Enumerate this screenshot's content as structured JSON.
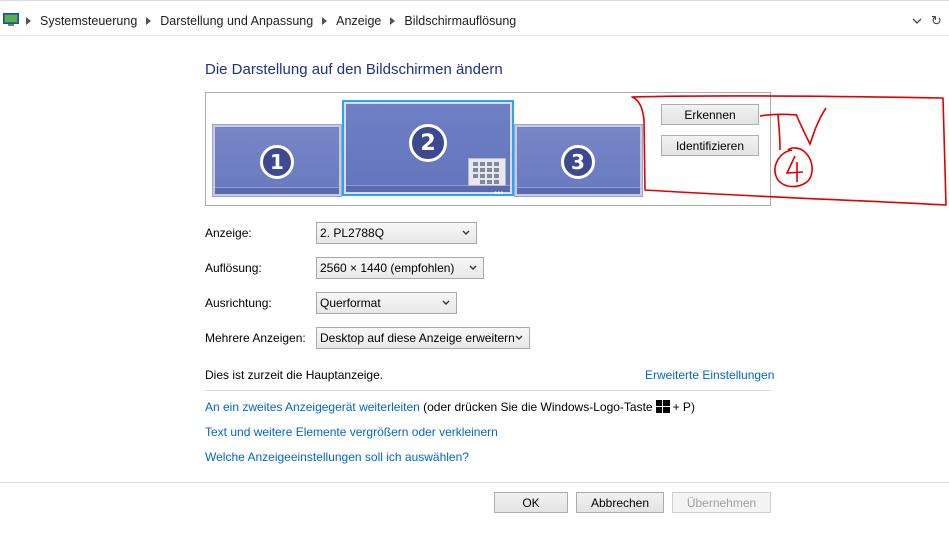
{
  "breadcrumb": {
    "items": [
      "Systemsteuerung",
      "Darstellung und Anpassung",
      "Anzeige",
      "Bildschirmauflösung"
    ]
  },
  "page": {
    "title": "Die Darstellung auf den Bildschirmen ändern"
  },
  "monitors": {
    "items": [
      {
        "number": "1",
        "selected": false
      },
      {
        "number": "2",
        "selected": true
      },
      {
        "number": "3",
        "selected": false
      }
    ],
    "detect_label": "Erkennen",
    "identify_label": "Identifizieren"
  },
  "form": {
    "display_label": "Anzeige:",
    "display_value": "2. PL2788Q",
    "resolution_label": "Auflösung:",
    "resolution_value": "2560 × 1440 (empfohlen)",
    "orientation_label": "Ausrichtung:",
    "orientation_value": "Querformat",
    "multiple_label": "Mehrere Anzeigen:",
    "multiple_value": "Desktop auf diese Anzeige erweitern"
  },
  "status": {
    "main_display_text": "Dies ist zurzeit die Hauptanzeige.",
    "advanced_link": "Erweiterte Einstellungen"
  },
  "links": {
    "project_link": "An ein zweites Anzeigegerät weiterleiten",
    "project_hint_before": "(oder drücken Sie die Windows-Logo-Taste",
    "project_hint_after": "+ P)",
    "text_size_link": "Text und weitere Elemente vergrößern oder verkleinern",
    "which_settings_link": "Welche Anzeigeeinstellungen soll ich auswählen?"
  },
  "buttons": {
    "ok": "OK",
    "cancel": "Abbrechen",
    "apply": "Übernehmen"
  },
  "annotation": {
    "handwritten_text": "TV 4",
    "color": "#e00000"
  },
  "colors": {
    "title": "#1e3287",
    "link": "#0066cc",
    "monitor": "#6a7ac0",
    "selected_border": "#2ea3f2"
  }
}
